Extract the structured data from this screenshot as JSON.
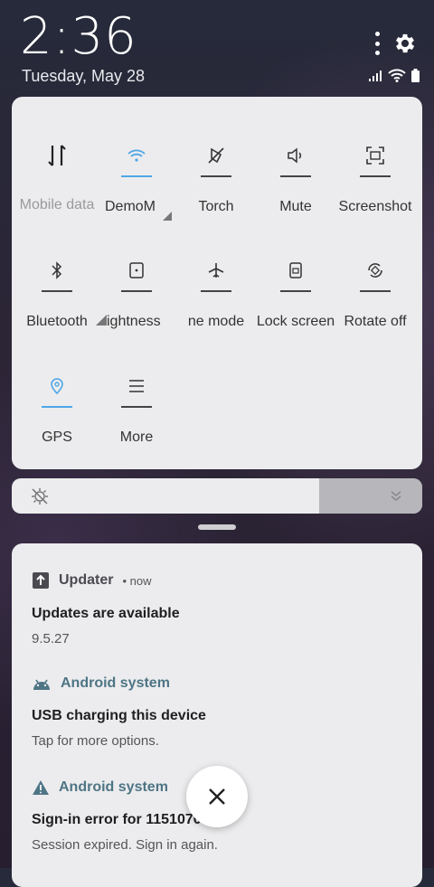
{
  "status": {
    "time": "2:36",
    "date": "Tuesday, May 28"
  },
  "quick_settings": {
    "tiles": [
      {
        "label": "Mobile data",
        "icon": "mobile-data-icon",
        "active": false
      },
      {
        "label": "DemoM",
        "icon": "wifi-icon",
        "active": true
      },
      {
        "label": "Torch",
        "icon": "torch-icon",
        "active": false
      },
      {
        "label": "Mute",
        "icon": "mute-icon",
        "active": false
      },
      {
        "label": "Screenshot",
        "icon": "screenshot-icon",
        "active": false
      },
      {
        "label": "Bluetooth",
        "icon": "bluetooth-icon",
        "active": false
      },
      {
        "label": "ightness",
        "icon": "brightness-icon",
        "active": false
      },
      {
        "label": "ne mode",
        "icon": "airplane-icon",
        "active": false
      },
      {
        "label": "Lock screen",
        "icon": "lock-screen-icon",
        "active": false
      },
      {
        "label": "Rotate off",
        "icon": "rotate-icon",
        "active": false
      },
      {
        "label": "GPS",
        "icon": "gps-icon",
        "active": true
      },
      {
        "label": "More",
        "icon": "more-menu-icon",
        "active": false
      }
    ]
  },
  "brightness": {
    "level": 0.75
  },
  "notifications": [
    {
      "app": "Updater",
      "time": "now",
      "title": "Updates are available",
      "body": "9.5.27",
      "icon": "update-icon"
    },
    {
      "app": "Android system",
      "title": "USB charging this device",
      "body": "Tap for more options.",
      "icon": "android-icon"
    },
    {
      "app": "Android system",
      "title": "Sign-in error for 1151070",
      "body": "Session expired. Sign in again.",
      "icon": "warning-icon"
    }
  ],
  "colors": {
    "accent": "#4fa6e6",
    "app_teal": "#4e7585"
  }
}
